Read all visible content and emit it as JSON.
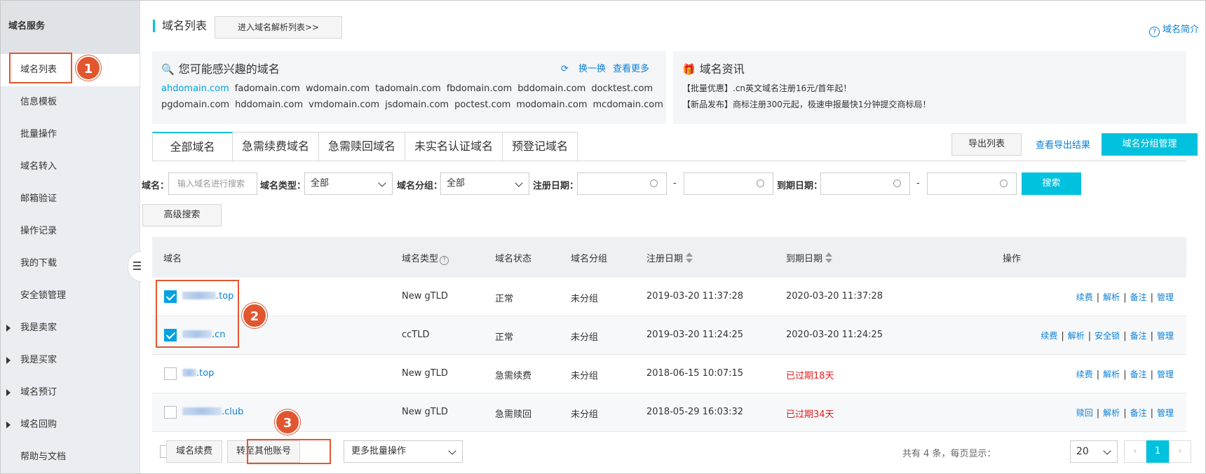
{
  "sidebar": {
    "title": "域名服务",
    "items": [
      {
        "label": "域名列表",
        "active": true,
        "expandable": false
      },
      {
        "label": "信息模板",
        "active": false,
        "expandable": false
      },
      {
        "label": "批量操作",
        "active": false,
        "expandable": false
      },
      {
        "label": "域名转入",
        "active": false,
        "expandable": false
      },
      {
        "label": "邮箱验证",
        "active": false,
        "expandable": false
      },
      {
        "label": "操作记录",
        "active": false,
        "expandable": false
      },
      {
        "label": "我的下载",
        "active": false,
        "expandable": false
      },
      {
        "label": "安全锁管理",
        "active": false,
        "expandable": false
      },
      {
        "label": "我是卖家",
        "active": false,
        "expandable": true
      },
      {
        "label": "我是买家",
        "active": false,
        "expandable": true
      },
      {
        "label": "域名预订",
        "active": false,
        "expandable": true
      },
      {
        "label": "域名回购",
        "active": false,
        "expandable": true
      },
      {
        "label": "帮助与文档",
        "active": false,
        "expandable": false
      }
    ]
  },
  "header": {
    "title": "域名列表",
    "dns_button": "进入域名解析列表>>",
    "intro_link": "域名简介"
  },
  "suggest": {
    "title": "您可能感兴趣的域名",
    "refresh": "换一换",
    "more": "查看更多",
    "domains": [
      "ahdomain.com",
      "fadomain.com",
      "wdomain.com",
      "tadomain.com",
      "fbdomain.com",
      "bddomain.com",
      "docktest.com",
      "pgdomain.com",
      "hddomain.com",
      "vmdomain.com",
      "jsdomain.com",
      "poctest.com",
      "modomain.com",
      "mcdomain.com"
    ]
  },
  "news": {
    "title": "域名资讯",
    "lines": [
      "【批量优惠】.cn英文域名注册16元/首年起！",
      "【新品发布】商标注册300元起，极速申报最快1分钟提交商标局！"
    ]
  },
  "tabs": [
    "全部域名",
    "急需续费域名",
    "急需赎回域名",
    "未实名认证域名",
    "预登记域名"
  ],
  "toolbar": {
    "export": "导出列表",
    "view_export": "查看导出结果",
    "group_manage": "域名分组管理"
  },
  "filters": {
    "domain_label": "域名：",
    "domain_placeholder": "输入域名进行搜索",
    "type_label": "域名类型：",
    "type_value": "全部",
    "group_label": "域名分组：",
    "group_value": "全部",
    "reg_label": "注册日期：",
    "exp_label": "到期日期：",
    "dash": "-",
    "search": "搜索",
    "advanced": "高级搜索"
  },
  "table": {
    "headers": {
      "name": "域名",
      "type": "域名类型",
      "status": "域名状态",
      "group": "域名分组",
      "reg": "注册日期",
      "exp": "到期日期",
      "ops": "操作"
    },
    "rows": [
      {
        "suffix": ".top",
        "checked": true,
        "type": "New gTLD",
        "status": "正常",
        "group": "未分组",
        "reg": "2019-03-20 11:37:28",
        "exp": "2020-03-20 11:37:28",
        "expired": false,
        "ops": [
          "续费",
          "解析",
          "备注",
          "管理"
        ]
      },
      {
        "suffix": ".cn",
        "checked": true,
        "type": "ccTLD",
        "status": "正常",
        "group": "未分组",
        "reg": "2019-03-20 11:24:25",
        "exp": "2020-03-20 11:24:25",
        "expired": false,
        "ops": [
          "续费",
          "解析",
          "安全锁",
          "备注",
          "管理"
        ]
      },
      {
        "suffix": ".top",
        "checked": false,
        "type": "New gTLD",
        "status": "急需续费",
        "group": "未分组",
        "reg": "2018-06-15 10:07:15",
        "exp": "已过期18天",
        "expired": true,
        "ops": [
          "续费",
          "解析",
          "备注",
          "管理"
        ]
      },
      {
        "suffix": ".club",
        "checked": false,
        "type": "New gTLD",
        "status": "急需赎回",
        "group": "未分组",
        "reg": "2018-05-29 16:03:32",
        "exp": "已过期34天",
        "expired": true,
        "ops": [
          "赎回",
          "解析",
          "备注",
          "管理"
        ]
      }
    ]
  },
  "footer": {
    "renew": "域名续费",
    "transfer": "转至其他账号",
    "more_batch": "更多批量操作",
    "page_info": "共有 4 条，每页显示：",
    "page_size": "20",
    "current_page": "1",
    "prev": "‹",
    "next": "›"
  },
  "annotations": [
    "1",
    "2",
    "3"
  ],
  "colors": {
    "accent": "#00c1de",
    "link": "#0a80d9",
    "annotation": "#e2562f",
    "expired": "#e02020"
  }
}
